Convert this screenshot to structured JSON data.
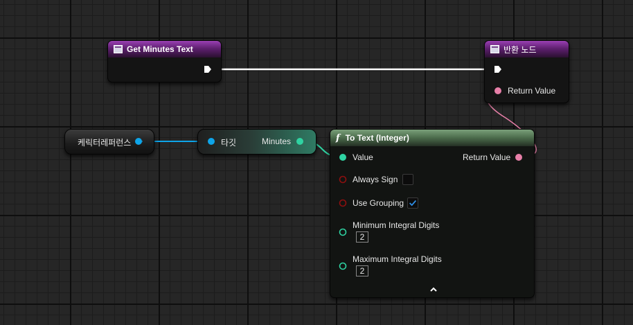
{
  "colors": {
    "exec": "#ffffff",
    "object_ref": "#0ea5e9",
    "integer": "#2fd3a2",
    "boolean": "#8f0f0f",
    "text_pin": "#e77fa8"
  },
  "nodes": {
    "get_minutes_text": {
      "title": "Get Minutes Text",
      "icon": "function-entry-icon"
    },
    "return_node": {
      "title": "반환 노드",
      "return_value_label": "Return Value",
      "icon": "function-return-icon"
    },
    "character_ref": {
      "label": "케릭터레퍼런스"
    },
    "target_get": {
      "input_label": "타깃",
      "output_label": "Minutes"
    },
    "to_text_integer": {
      "title": "To Text (Integer)",
      "icon": "function-icon",
      "value_label": "Value",
      "return_value_label": "Return Value",
      "always_sign_label": "Always Sign",
      "always_sign_checked": false,
      "use_grouping_label": "Use Grouping",
      "use_grouping_checked": true,
      "min_digits_label": "Minimum Integral Digits",
      "min_digits_value": "2",
      "max_digits_label": "Maximum Integral Digits",
      "max_digits_value": "2",
      "collapse_icon": "chevron-up-icon"
    }
  }
}
